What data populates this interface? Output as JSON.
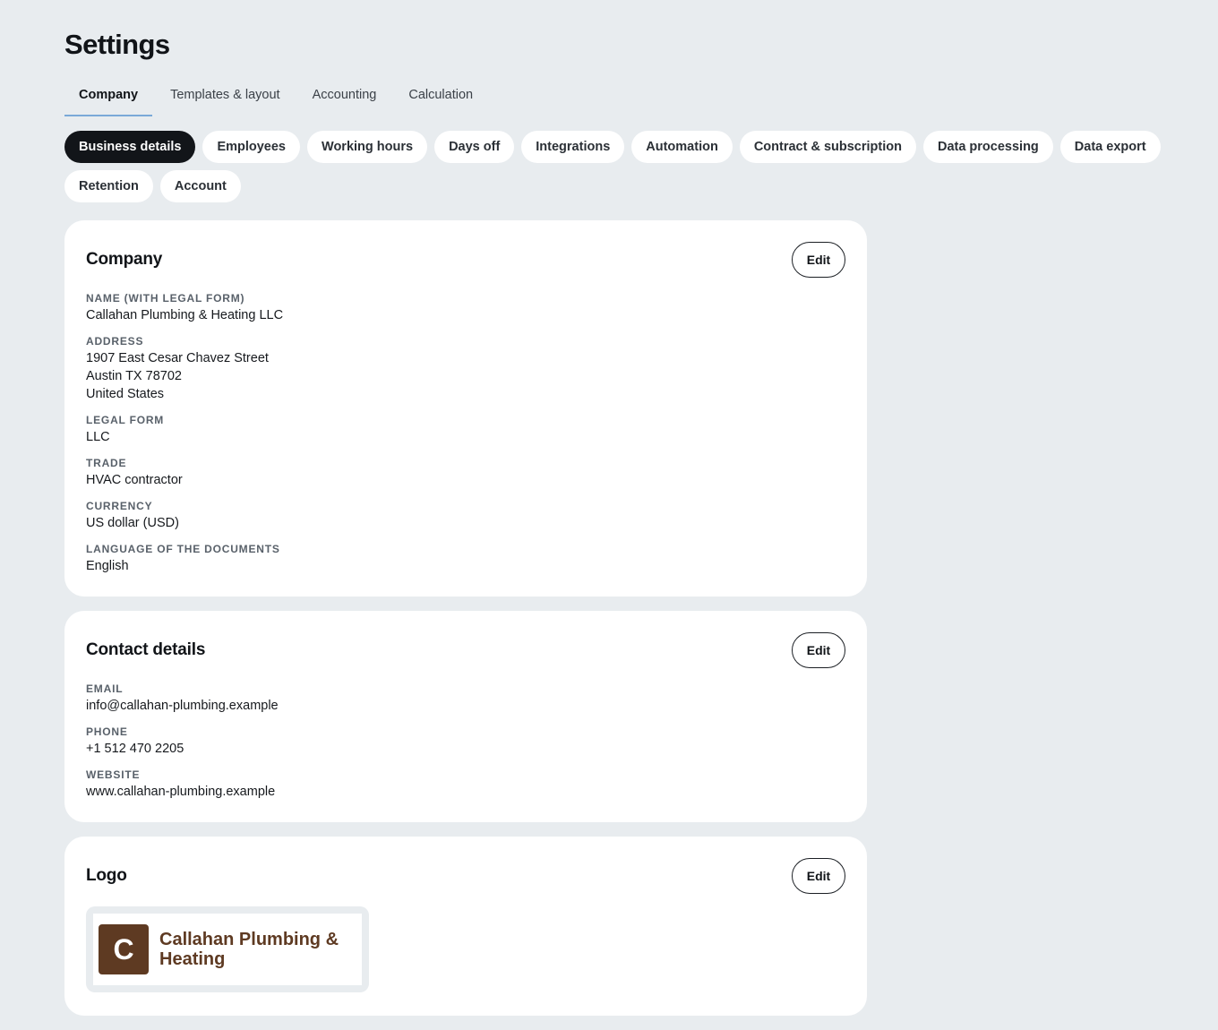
{
  "page": {
    "title": "Settings"
  },
  "tabs": [
    {
      "label": "Company",
      "active": true
    },
    {
      "label": "Templates & layout",
      "active": false
    },
    {
      "label": "Accounting",
      "active": false
    },
    {
      "label": "Calculation",
      "active": false
    }
  ],
  "subnav": [
    {
      "label": "Business details",
      "active": true
    },
    {
      "label": "Employees"
    },
    {
      "label": "Working hours"
    },
    {
      "label": "Days off"
    },
    {
      "label": "Integrations"
    },
    {
      "label": "Automation"
    },
    {
      "label": "Contract & subscription"
    },
    {
      "label": "Data processing"
    },
    {
      "label": "Data export"
    },
    {
      "label": "Retention"
    },
    {
      "label": "Account"
    }
  ],
  "company": {
    "title": "Company",
    "edit_label": "Edit",
    "name_label": "Name (with legal form)",
    "name_value": "Callahan Plumbing & Heating LLC",
    "address_label": "Address",
    "address_line1": "1907 East Cesar Chavez Street",
    "address_line2": "Austin TX 78702",
    "address_line3": "United States",
    "legal_form_label": "Legal form",
    "legal_form_value": "LLC",
    "trade_label": "Trade",
    "trade_value": "HVAC contractor",
    "currency_label": "Currency",
    "currency_value": "US dollar (USD)",
    "language_label": "Language of the documents",
    "language_value": "English"
  },
  "contact": {
    "title": "Contact details",
    "edit_label": "Edit",
    "email_label": "Email",
    "email_value": "info@callahan-plumbing.example",
    "phone_label": "Phone",
    "phone_value": "+1 512 470 2205",
    "website_label": "Website",
    "website_value": "www.callahan-plumbing.example"
  },
  "logo": {
    "title": "Logo",
    "edit_label": "Edit",
    "mark_letter": "C",
    "company_name": "Callahan Plumbing & Heating",
    "brand_color": "#5e3a22"
  },
  "colors": {
    "background": "#e8ecef",
    "active_chip": "#121519",
    "tab_underline": "#7aa9d8"
  }
}
